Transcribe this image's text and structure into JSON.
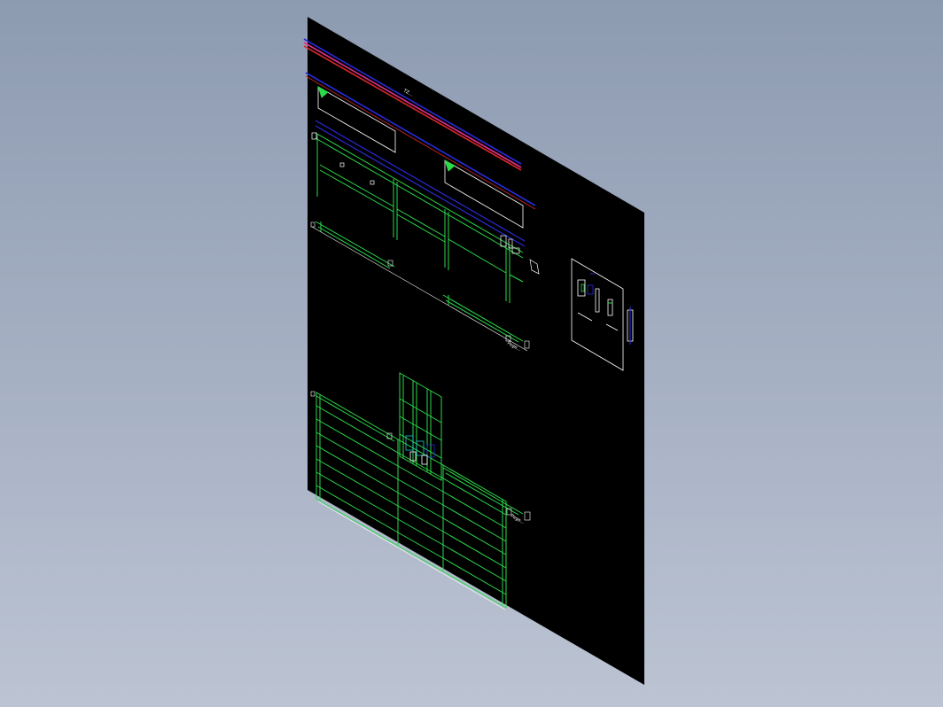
{
  "viewer": {
    "background_colors": [
      "#8d9bb1",
      "#bcc4d3"
    ],
    "sheet_color": "#000000"
  },
  "drawing": {
    "colors": {
      "green": "#2bd94a",
      "blue": "#2a2ad8",
      "magenta": "#e0308a",
      "red": "#d62828",
      "white": "#ffffff",
      "cyan": "#25c7d0"
    },
    "labels": {
      "top_note": "TZ...",
      "dim_a": "Page...",
      "dim_b": "Page..."
    }
  }
}
